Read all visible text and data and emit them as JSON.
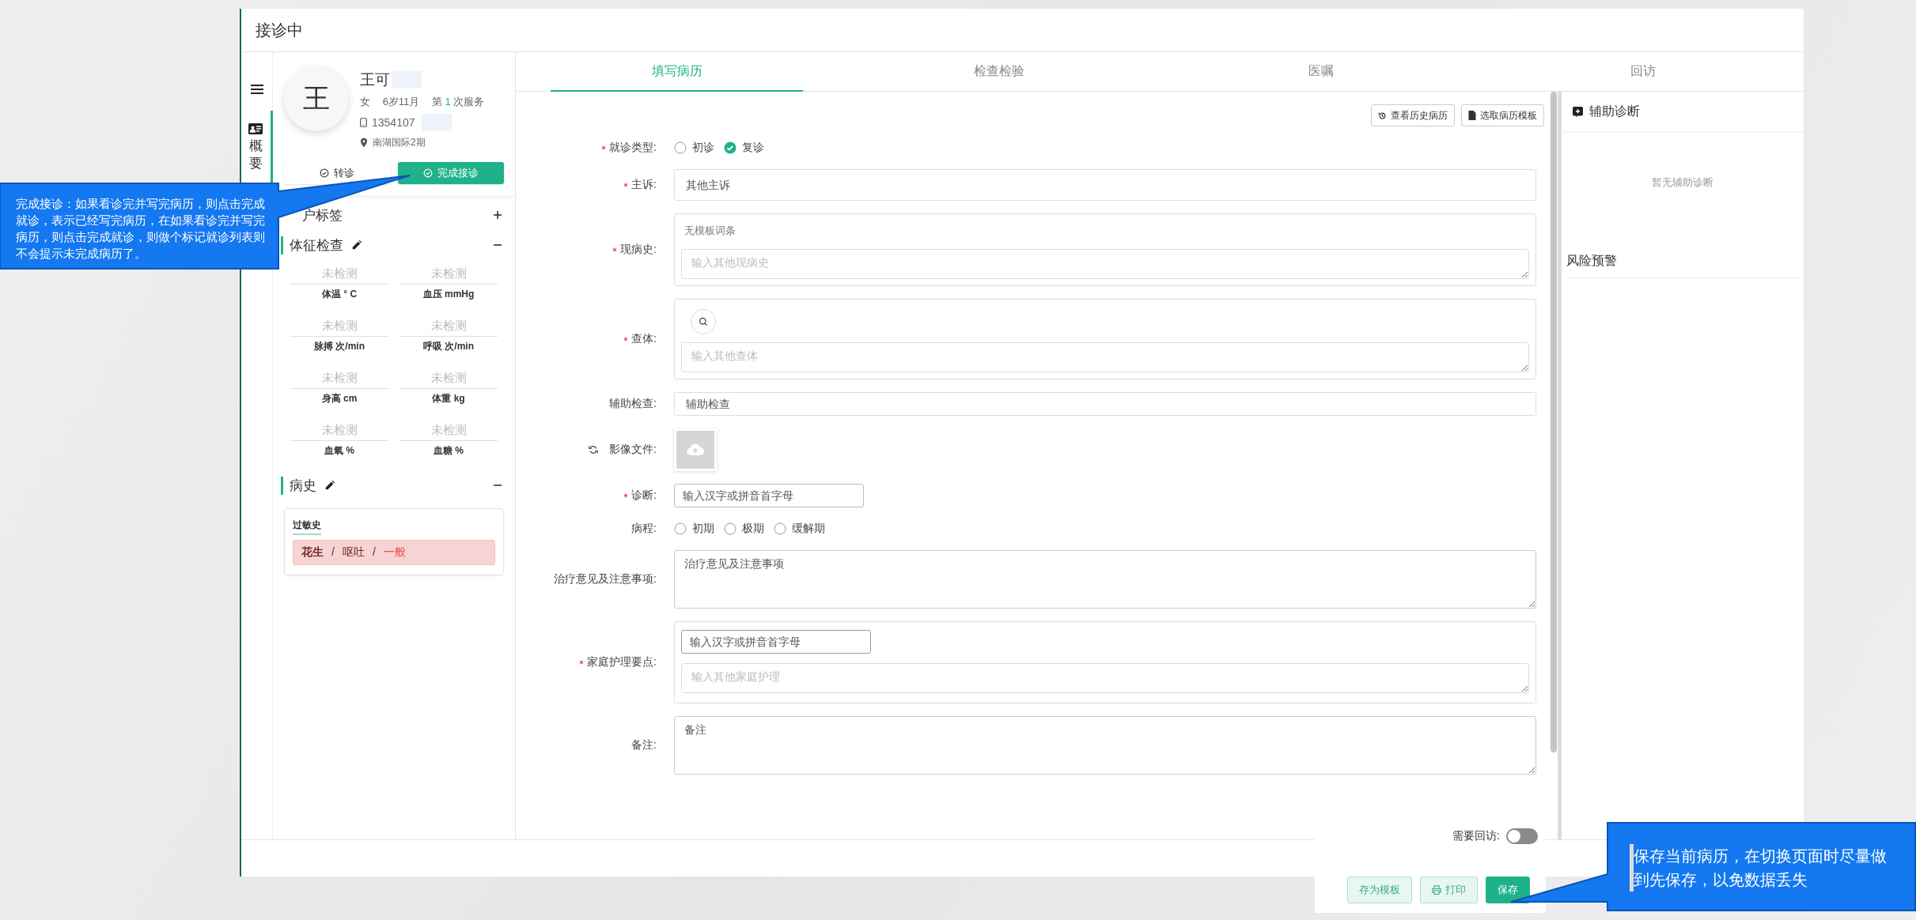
{
  "window": {
    "title": "接诊中"
  },
  "nav": {
    "items": [
      {
        "label": "概要",
        "selected": true
      }
    ]
  },
  "patient": {
    "avatar": "王",
    "name": "王可",
    "gender": "女",
    "age": "6岁11月",
    "visit_prefix": "第",
    "visit_count": "1",
    "visit_suffix": "次服务",
    "phone": "1354107",
    "address": "南湖国际2期",
    "actions": [
      {
        "label": "转诊",
        "kind": "default"
      },
      {
        "label": "完成接诊",
        "kind": "primary"
      }
    ],
    "sections": [
      {
        "title": "户标签",
        "editable": false,
        "expanded": false
      },
      {
        "title": "体征检查",
        "editable": true,
        "expanded": true
      },
      {
        "title": "病史",
        "editable": true,
        "expanded": true
      }
    ],
    "vitals": [
      {
        "value": "未检测",
        "label": "体温 ° C"
      },
      {
        "value": "未检测",
        "label": "血压 mmHg"
      },
      {
        "value": "未检测",
        "label": "脉搏 次/min"
      },
      {
        "value": "未检测",
        "label": "呼吸 次/min"
      },
      {
        "value": "未检测",
        "label": "身高 cm"
      },
      {
        "value": "未检测",
        "label": "体重 kg"
      },
      {
        "value": "未检测",
        "label": "血氧 %"
      },
      {
        "value": "未检测",
        "label": "血糖 %"
      }
    ],
    "history": {
      "title": "过敏史",
      "parts": [
        {
          "text": "花生",
          "kind": "allergen"
        },
        {
          "text": "/",
          "kind": "separator"
        },
        {
          "text": "呕吐",
          "kind": "reaction"
        },
        {
          "text": "/",
          "kind": "separator"
        },
        {
          "text": "一般",
          "kind": "severity"
        }
      ]
    }
  },
  "tabs": [
    {
      "label": "填写病历",
      "selected": true
    },
    {
      "label": "检查检验",
      "selected": false
    },
    {
      "label": "医嘱",
      "selected": false
    },
    {
      "label": "回访",
      "selected": false
    }
  ],
  "form": {
    "toolbar": [
      {
        "label": "查看历史病历",
        "kind": "history"
      },
      {
        "label": "选取病历模板",
        "kind": "template"
      }
    ],
    "rows": [
      {
        "kind": "radio",
        "label": "就诊类型:",
        "required": true,
        "options": [
          {
            "label": "初诊",
            "selected": false
          },
          {
            "label": "复诊",
            "selected": true
          }
        ]
      },
      {
        "kind": "input",
        "label": "主诉:",
        "required": true,
        "placeholder": "其他主诉"
      },
      {
        "kind": "template",
        "label": "现病史:",
        "required": true,
        "note": "无模板词条",
        "placeholder": "输入其他现病史"
      },
      {
        "kind": "search",
        "label": "查体:",
        "required": true,
        "placeholder": "输入其他查体"
      },
      {
        "kind": "input",
        "label": "辅助检查:",
        "required": false,
        "placeholder": "辅助检查"
      },
      {
        "kind": "upload",
        "label": "影像文件:",
        "required": false
      },
      {
        "kind": "lookup",
        "label": "诊断:",
        "required": true,
        "placeholder": "输入汉字或拼音首字母"
      },
      {
        "kind": "radio",
        "label": "病程:",
        "required": false,
        "options": [
          {
            "label": "初期",
            "selected": false
          },
          {
            "label": "极期",
            "selected": false
          },
          {
            "label": "缓解期",
            "selected": false
          }
        ]
      },
      {
        "kind": "textarea",
        "label": "治疗意见及注意事项:",
        "required": false,
        "placeholder": "治疗意见及注意事项"
      },
      {
        "kind": "lookup-note",
        "label": "家庭护理要点:",
        "required": true,
        "lookup_placeholder": "输入汉字或拼音首字母",
        "placeholder": "输入其他家庭护理"
      },
      {
        "kind": "textarea",
        "label": "备注:",
        "required": false,
        "placeholder": "备注"
      }
    ]
  },
  "assist": {
    "title": "辅助诊断",
    "empty": "暂无辅助诊断",
    "risk_title": "风险预警"
  },
  "save_bar": {
    "followup_label": "需要回访:",
    "followup_on": false,
    "buttons": [
      {
        "label": "存为模板",
        "kind": "outline"
      },
      {
        "label": "打印",
        "kind": "print"
      },
      {
        "label": "保存",
        "kind": "primary"
      }
    ]
  },
  "callouts": [
    {
      "text": "完成接诊：如果看诊完并写完病历，则点击完成就诊，表示已经写完病历，在如果看诊完并写完病历，则点击完成就诊，则做个标记就诊列表则不会提示未完成病历了。",
      "kind": "left"
    },
    {
      "text": "保存当前病历，在切换页面时尽量做到先保存，以免数据丢失",
      "kind": "right"
    }
  ]
}
